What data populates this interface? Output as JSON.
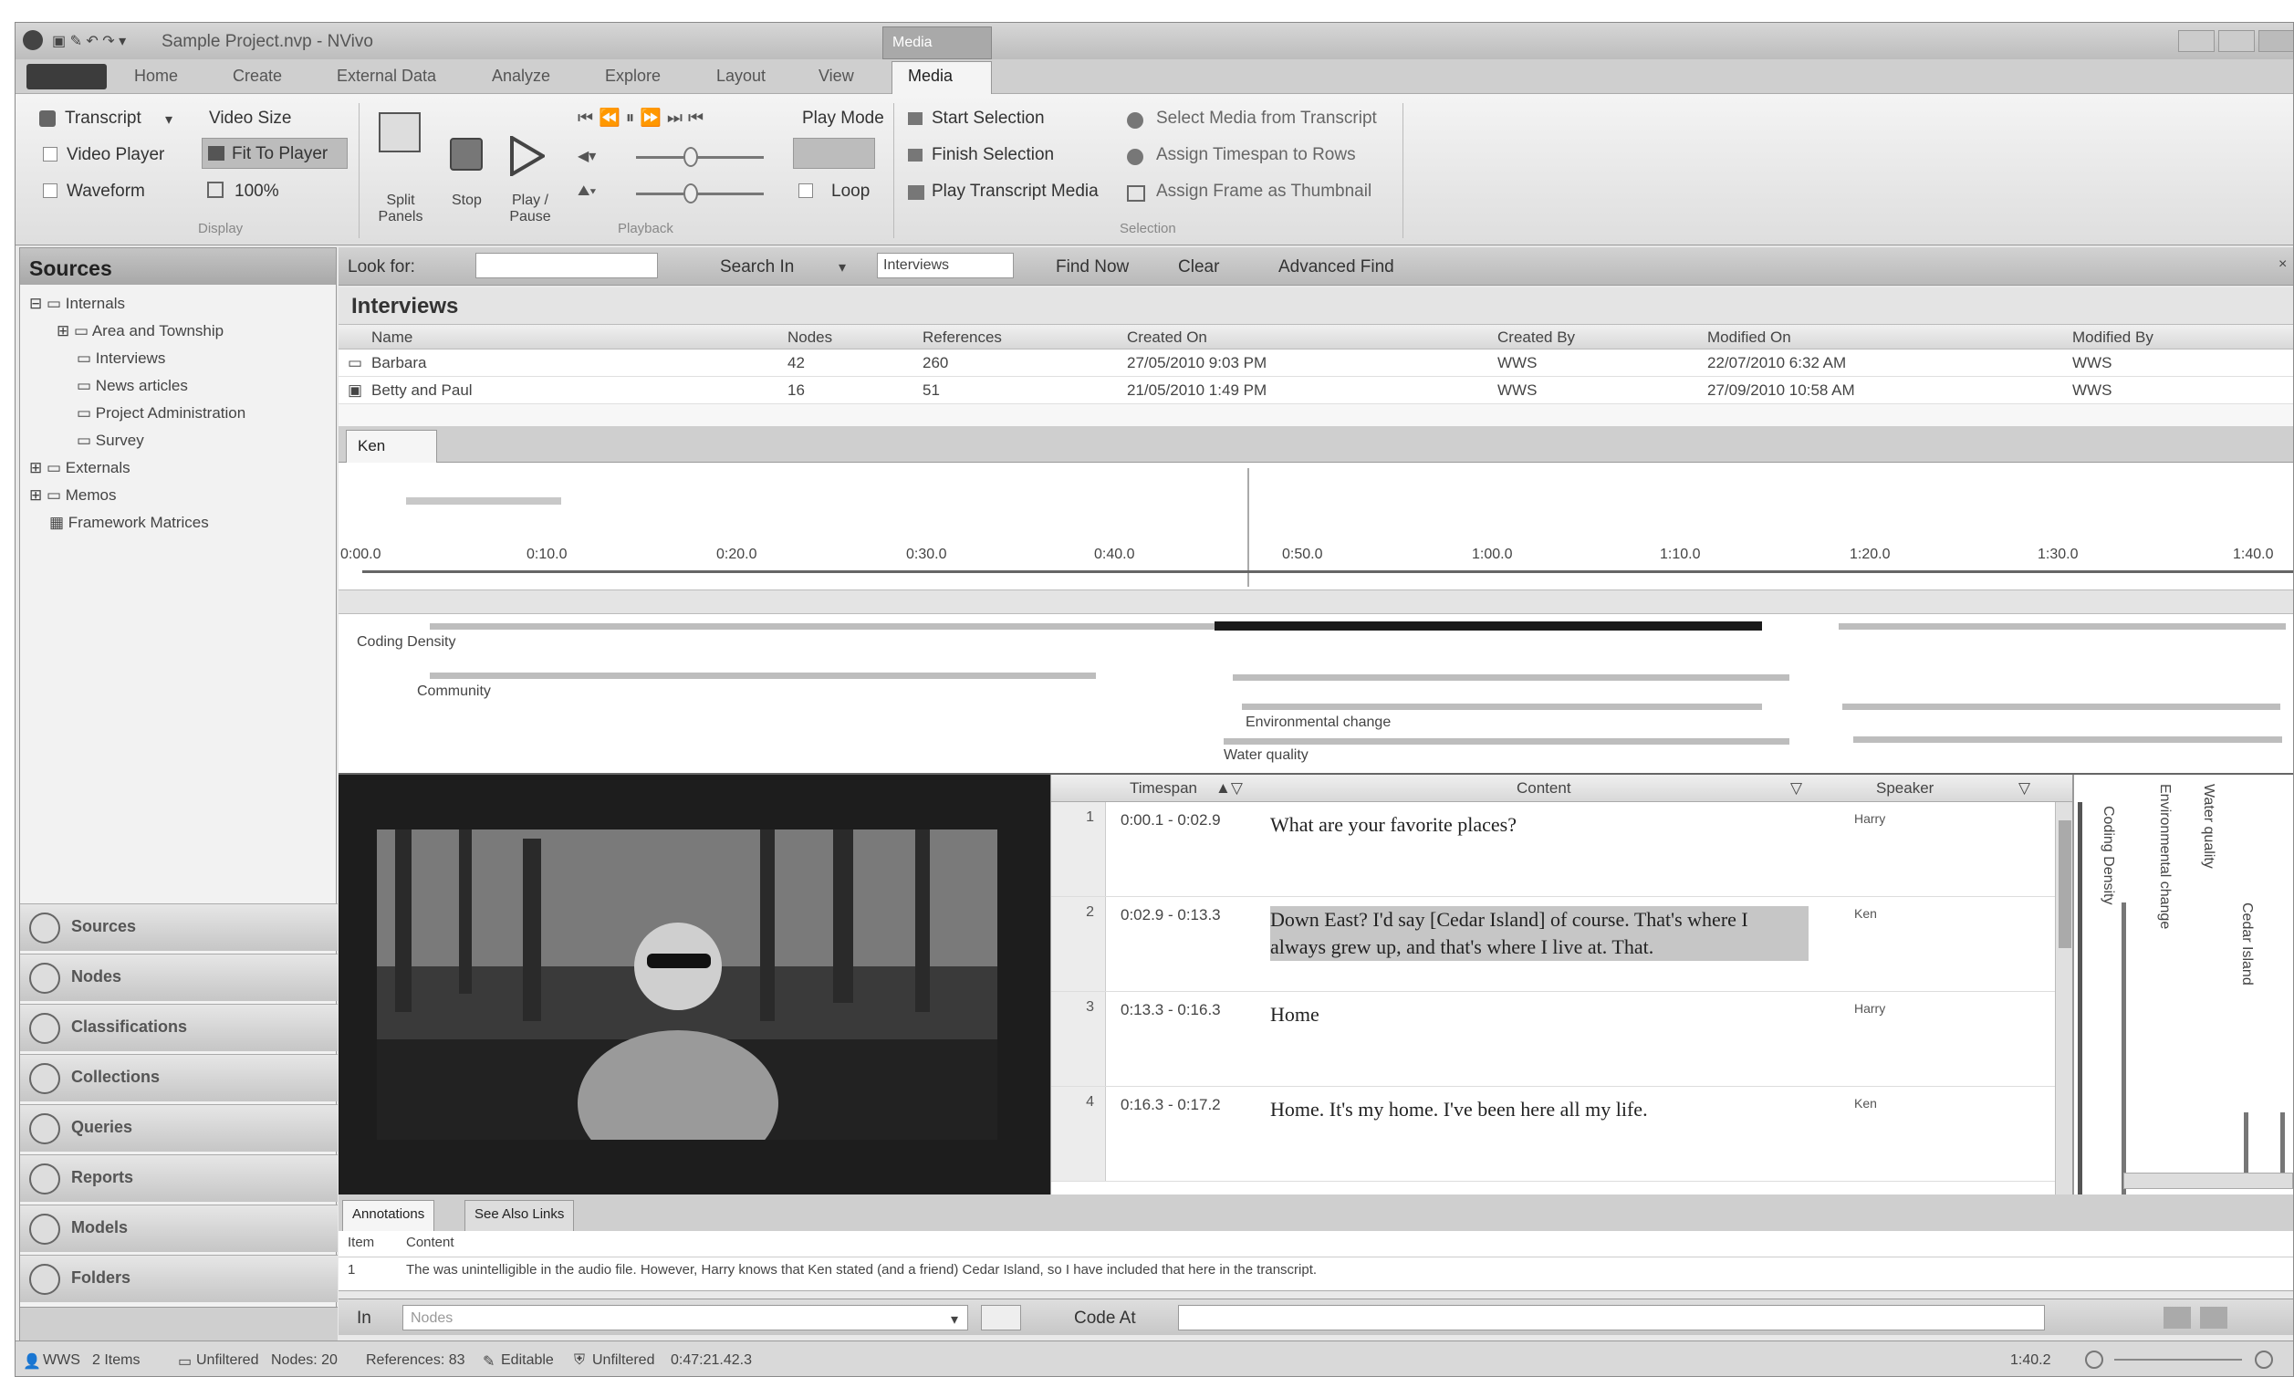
{
  "titlebar": {
    "title": "Sample Project.nvp - NVivo",
    "context_tab": "Media"
  },
  "ribbon_tabs": [
    "Home",
    "Create",
    "External Data",
    "Analyze",
    "Explore",
    "Layout",
    "View",
    "Media"
  ],
  "ribbon": {
    "display": {
      "transcript": "Transcript",
      "video_player": "Video Player",
      "waveform": "Waveform",
      "video_size": "Video Size",
      "fit_to_player": "Fit To Player",
      "zoom": "100%",
      "label": "Display"
    },
    "split_panels": "Split Panels",
    "stop": "Stop",
    "play_pause": "Play / Pause",
    "playback_label": "Playback",
    "play_mode": "Play Mode",
    "loop": "Loop",
    "selection": {
      "start": "Start Selection",
      "finish": "Finish Selection",
      "play_transcript": "Play Transcript Media",
      "select_media": "Select Media from Transcript",
      "assign_timespan": "Assign Timespan to Rows",
      "assign_frame": "Assign Frame as Thumbnail",
      "label": "Selection"
    }
  },
  "sources": {
    "header": "Sources",
    "tree": [
      "Internals",
      "Area and Township",
      "Interviews",
      "News articles",
      "Project Administration",
      "Survey",
      "Externals",
      "Memos",
      "Framework Matrices"
    ]
  },
  "nav": [
    "Sources",
    "Nodes",
    "Classifications",
    "Collections",
    "Queries",
    "Reports",
    "Models",
    "Folders"
  ],
  "findbar": {
    "look_for": "Look for:",
    "search_in": "Search In",
    "scope": "Interviews",
    "find_now": "Find Now",
    "clear": "Clear",
    "advanced_find": "Advanced Find"
  },
  "list": {
    "title": "Interviews",
    "columns": [
      "Name",
      "Nodes",
      "References",
      "Created On",
      "Created By",
      "Modified On",
      "Modified By"
    ],
    "rows": [
      [
        "Barbara",
        "42",
        "260",
        "27/05/2010 9:03 PM",
        "WWS",
        "22/07/2010 6:32 AM",
        "WWS"
      ],
      [
        "Betty and Paul",
        "16",
        "51",
        "21/05/2010 1:49 PM",
        "WWS",
        "27/09/2010 10:58 AM",
        "WWS"
      ]
    ]
  },
  "detail_tab": "Ken",
  "timeline_ticks": [
    "0:00.0",
    "0:10.0",
    "0:20.0",
    "0:30.0",
    "0:40.0",
    "0:50.0",
    "1:00.0",
    "1:10.0",
    "1:20.0",
    "1:30.0",
    "1:40.0"
  ],
  "stripes": {
    "coding_density": "Coding Density",
    "community": "Community",
    "environmental_change": "Environmental change",
    "water_quality": "Water quality"
  },
  "transcript": {
    "columns": [
      "Timespan",
      "Content",
      "Speaker"
    ],
    "rows": [
      {
        "n": "1",
        "ts": "0:00.1 - 0:02.9",
        "content": "What are your favorite places?",
        "speaker": "Harry"
      },
      {
        "n": "2",
        "ts": "0:02.9 - 0:13.3",
        "content": "Down East? I'd say [Cedar Island] of course. That's where I always grew up, and that's where I live at. That.",
        "speaker": "Ken"
      },
      {
        "n": "3",
        "ts": "0:13.3 - 0:16.3",
        "content": "Home",
        "speaker": "Harry"
      },
      {
        "n": "4",
        "ts": "0:16.3 - 0:17.2",
        "content": "Home. It's my home. I've been here all my life.",
        "speaker": "Ken"
      }
    ]
  },
  "stripe_v_labels": [
    "Coding Density",
    "Environmental change",
    "Water quality",
    "Cedar Island"
  ],
  "annotations": {
    "tabs": [
      "Annotations",
      "See Also Links"
    ],
    "columns": [
      "Item",
      "Content"
    ],
    "row": [
      "1",
      "The was unintelligible in the audio file. However, Harry knows that Ken stated (and a friend) Cedar Island, so I have included that here in the transcript."
    ]
  },
  "codebar": {
    "in": "In",
    "placeholder": "Nodes",
    "code_at": "Code At"
  },
  "status": {
    "user": "WWS",
    "items": "2 Items",
    "unfiltered_label": "Unfiltered",
    "nodes": "Nodes: 20",
    "refs": "References: 83",
    "editable": "Editable",
    "unfiltered": "Unfiltered",
    "duration": "0:47:21.42.3",
    "position": "1:40.2"
  }
}
